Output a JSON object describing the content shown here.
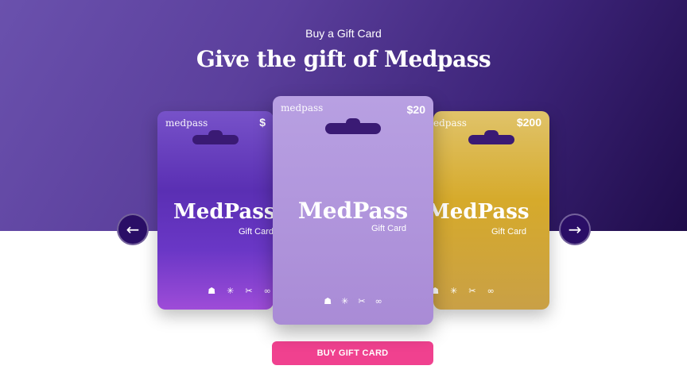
{
  "header": {
    "eyebrow": "Buy a Gift Card",
    "headline": "Give the gift of  Medpass"
  },
  "cards": [
    {
      "id": "left",
      "brand_small": "medpass",
      "amount": "$",
      "brand": "MedPass",
      "sub": "Gift Card",
      "icons": [
        "☗",
        "✳",
        "✂",
        "∞"
      ]
    },
    {
      "id": "center",
      "brand_small": "medpass",
      "amount": "$20",
      "brand": "MedPass",
      "sub": "Gift Card",
      "icons": [
        "☗",
        "✳",
        "✂",
        "∞"
      ]
    },
    {
      "id": "right",
      "brand_small": "edpass",
      "amount": "$200",
      "brand": "MedPass",
      "sub": "Gift Card",
      "icons": [
        "☗",
        "✳",
        "✂",
        "∞"
      ]
    }
  ],
  "nav": {
    "prev_icon": "arrow-left-icon",
    "next_icon": "arrow-right-icon",
    "prev_glyph": "←",
    "next_glyph": "→"
  },
  "cta": {
    "label": "BUY GIFT CARD"
  },
  "colors": {
    "hero_start": "#6a51ad",
    "hero_end": "#1f0c4a",
    "cta": "#f0418f",
    "nav": "#2a0e66"
  }
}
